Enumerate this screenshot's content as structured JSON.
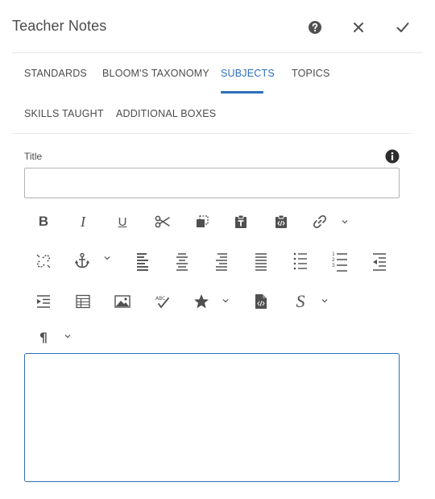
{
  "header": {
    "title": "Teacher Notes",
    "help_icon": "help-icon",
    "close_icon": "close-icon",
    "done_icon": "checkmark-icon"
  },
  "tabs": [
    {
      "label": "STANDARDS",
      "selected": false
    },
    {
      "label": "BLOOM'S TAXONOMY",
      "selected": false
    },
    {
      "label": "SUBJECTS",
      "selected": true
    },
    {
      "label": "TOPICS",
      "selected": false
    },
    {
      "label": "SKILLS TAUGHT",
      "selected": false
    },
    {
      "label": "ADDITIONAL BOXES",
      "selected": false
    }
  ],
  "form": {
    "title_label": "Title",
    "title_value": "",
    "title_placeholder": "",
    "body_value": ""
  },
  "toolbar": {
    "bold": "B",
    "italic": "I",
    "underline": "U",
    "spellcheck_mark": "ABC",
    "paragraph": "¶",
    "style": "S",
    "icons": [
      "bold-icon",
      "italic-icon",
      "underline-icon",
      "cut-icon",
      "copy-icon",
      "paste-text-icon",
      "paste-html-icon",
      "link-icon",
      "unlink-icon",
      "anchor-icon",
      "align-left-icon",
      "align-center-icon",
      "align-right-icon",
      "justify-icon",
      "bulleted-list-icon",
      "numbered-list-icon",
      "outdent-icon",
      "indent-icon",
      "table-icon",
      "image-icon",
      "spellcheck-icon",
      "special-characters-icon",
      "source-edit-icon",
      "styles-icon",
      "paragraph-format-icon"
    ]
  },
  "colors": {
    "accent": "#2d6fb9",
    "text": "#4b4b4b",
    "border": "#b3b3b3",
    "divider": "#e6e6e6"
  }
}
